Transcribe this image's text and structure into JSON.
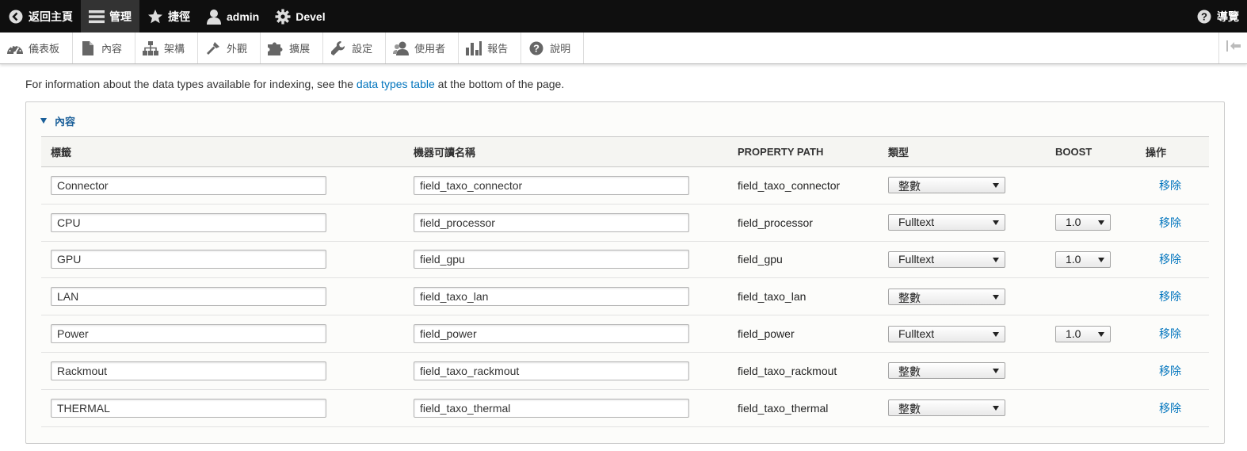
{
  "toolbar": {
    "back_home": "返回主頁",
    "manage": "管理",
    "shortcuts": "捷徑",
    "user": "admin",
    "devel": "Devel",
    "help": "導覽"
  },
  "tray": {
    "items": [
      {
        "label": "儀表板",
        "icon": "dashboard-icon"
      },
      {
        "label": "內容",
        "icon": "content-page-icon"
      },
      {
        "label": "架構",
        "icon": "structure-icon"
      },
      {
        "label": "外觀",
        "icon": "appearance-brush-icon"
      },
      {
        "label": "擴展",
        "icon": "puzzle-icon"
      },
      {
        "label": "設定",
        "icon": "wrench-icon"
      },
      {
        "label": "使用者",
        "icon": "people-icon"
      },
      {
        "label": "報告",
        "icon": "bar-chart-icon"
      },
      {
        "label": "說明",
        "icon": "help-icon"
      }
    ]
  },
  "intro": {
    "before": "For information about the data types available for indexing, see the ",
    "link": "data types table",
    "after": " at the bottom of the page."
  },
  "fieldset": {
    "legend": "內容"
  },
  "table": {
    "headers": {
      "label": "標籤",
      "machine_name": "機器可讀名稱",
      "property_path": "PROPERTY PATH",
      "type": "類型",
      "boost": "BOOST",
      "operations": "操作"
    },
    "remove_label": "移除",
    "rows": [
      {
        "label": "Connector",
        "machine_name": "field_taxo_connector",
        "property_path": "field_taxo_connector",
        "type": "整數",
        "boost": ""
      },
      {
        "label": "CPU",
        "machine_name": "field_processor",
        "property_path": "field_processor",
        "type": "Fulltext",
        "boost": "1.0"
      },
      {
        "label": "GPU",
        "machine_name": "field_gpu",
        "property_path": "field_gpu",
        "type": "Fulltext",
        "boost": "1.0"
      },
      {
        "label": "LAN",
        "machine_name": "field_taxo_lan",
        "property_path": "field_taxo_lan",
        "type": "整數",
        "boost": ""
      },
      {
        "label": "Power",
        "machine_name": "field_power",
        "property_path": "field_power",
        "type": "Fulltext",
        "boost": "1.0"
      },
      {
        "label": "Rackmout",
        "machine_name": "field_taxo_rackmout",
        "property_path": "field_taxo_rackmout",
        "type": "整數",
        "boost": ""
      },
      {
        "label": "THERMAL",
        "machine_name": "field_taxo_thermal",
        "property_path": "field_taxo_thermal",
        "type": "整數",
        "boost": ""
      }
    ]
  },
  "colors": {
    "toolbar_bg": "#0f0f0f",
    "link": "#0074bd",
    "legend": "#1a5f99"
  }
}
